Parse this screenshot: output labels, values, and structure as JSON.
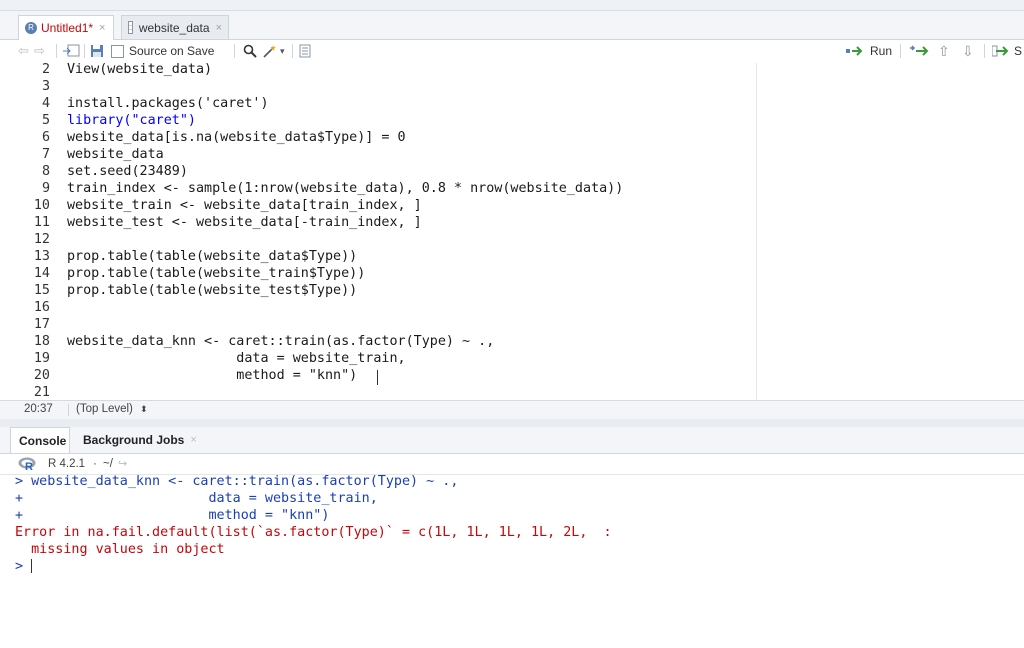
{
  "tabs": [
    {
      "label": "Untitled1*",
      "active": true
    },
    {
      "label": "website_data",
      "active": false
    }
  ],
  "toolbar": {
    "source_on_save_label": "Source on Save",
    "run_label": "Run",
    "source_label": "S"
  },
  "editor": {
    "lines": [
      {
        "num": "2",
        "text": "View(website_data)"
      },
      {
        "num": "3",
        "text": ""
      },
      {
        "num": "4",
        "text": "install.packages('caret')"
      },
      {
        "num": "5",
        "text": "library(\"caret\")"
      },
      {
        "num": "6",
        "text": "website_data[is.na(website_data$Type)] = 0"
      },
      {
        "num": "7",
        "text": "website_data"
      },
      {
        "num": "8",
        "text": "set.seed(23489)"
      },
      {
        "num": "9",
        "text": "train_index <- sample(1:nrow(website_data), 0.8 * nrow(website_data))"
      },
      {
        "num": "10",
        "text": "website_train <- website_data[train_index, ]"
      },
      {
        "num": "11",
        "text": "website_test <- website_data[-train_index, ]"
      },
      {
        "num": "12",
        "text": ""
      },
      {
        "num": "13",
        "text": "prop.table(table(website_data$Type))"
      },
      {
        "num": "14",
        "text": "prop.table(table(website_train$Type))"
      },
      {
        "num": "15",
        "text": "prop.table(table(website_test$Type))"
      },
      {
        "num": "16",
        "text": ""
      },
      {
        "num": "17",
        "text": ""
      },
      {
        "num": "18",
        "text": "website_data_knn <- caret::train(as.factor(Type) ~ .,"
      },
      {
        "num": "19",
        "text": "                     data = website_train,"
      },
      {
        "num": "20",
        "text": "                     method = \"knn\")"
      },
      {
        "num": "21",
        "text": ""
      }
    ]
  },
  "status": {
    "position": "20:37",
    "scope": "(Top Level)"
  },
  "console_tabs": [
    {
      "label": "Console",
      "active": true
    },
    {
      "label": "Background Jobs",
      "active": false
    }
  ],
  "r_info": {
    "version": "R 4.2.1",
    "dot": "·",
    "path": "~/"
  },
  "console": {
    "lines": [
      {
        "prefix": ">",
        "text": "website_data_knn <- caret::train(as.factor(Type) ~ .,",
        "style": "blue"
      },
      {
        "prefix": "+",
        "text": "                       data = website_train,",
        "style": "blue"
      },
      {
        "prefix": "+",
        "text": "                       method = \"knn\")",
        "style": "blue"
      },
      {
        "prefix": "",
        "text": "Error in na.fail.default(list(`as.factor(Type)` = c(1L, 1L, 1L, 1L, 2L,  :",
        "style": "red"
      },
      {
        "prefix": "",
        "text": "  missing values in object",
        "style": "red"
      },
      {
        "prefix": ">",
        "text": "",
        "style": "blue"
      }
    ]
  },
  "colors": {
    "console_input": "#1a3fb5",
    "console_error": "#c5060b",
    "keyword": "#0000ff",
    "string": "#036a07"
  }
}
